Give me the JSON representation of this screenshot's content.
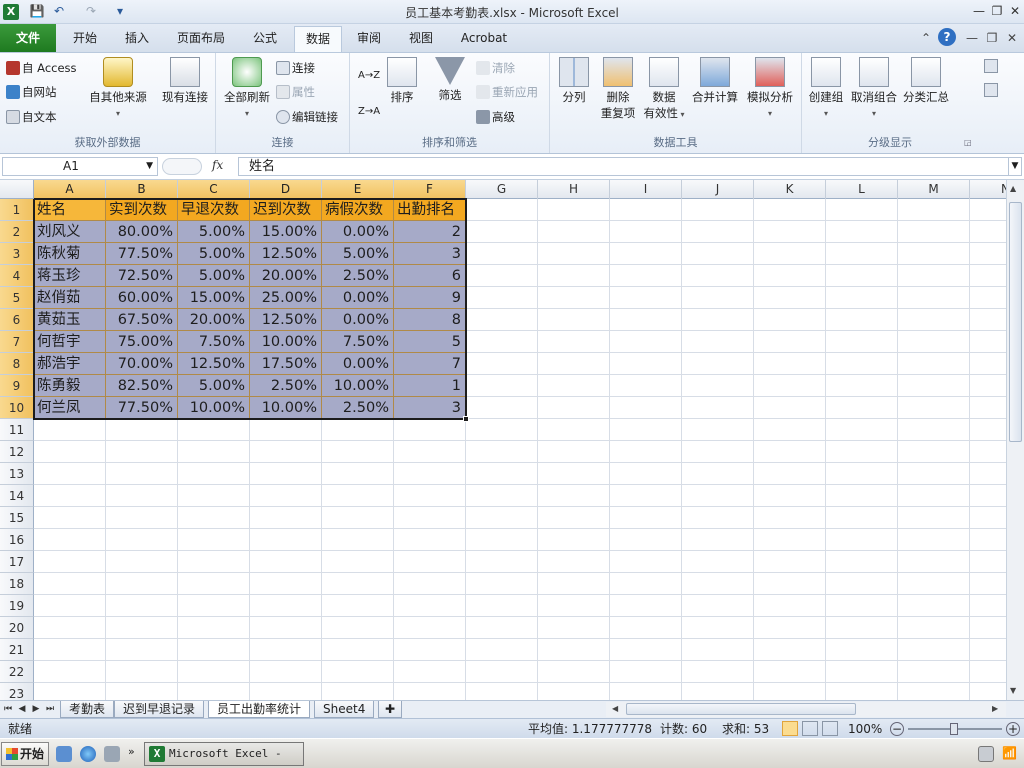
{
  "window": {
    "title": "员工基本考勤表.xlsx - Microsoft Excel",
    "minimize": "—",
    "restore": "❐",
    "close": "✕"
  },
  "qat": {
    "save": "💾",
    "undo": "↶",
    "redo": "↷",
    "customize": "▾"
  },
  "tabs": [
    {
      "label": "文件"
    },
    {
      "label": "开始"
    },
    {
      "label": "插入"
    },
    {
      "label": "页面布局"
    },
    {
      "label": "公式"
    },
    {
      "label": "数据"
    },
    {
      "label": "审阅"
    },
    {
      "label": "视图"
    },
    {
      "label": "Acrobat"
    }
  ],
  "ribbon_right": {
    "collapse": "⌃",
    "help": "?"
  },
  "ribbon": {
    "get_external": {
      "label": "获取外部数据",
      "access": "自 Access",
      "web": "自网站",
      "text": "自文本",
      "other": "自其他来源",
      "existing": "现有连接"
    },
    "connections": {
      "label": "连接",
      "refresh_all": "全部刷新",
      "connections": "连接",
      "properties": "属性",
      "edit_links": "编辑链接"
    },
    "sort_filter": {
      "label": "排序和筛选",
      "sort_az": "A→Z",
      "sort_za": "Z→A",
      "sort": "排序",
      "filter": "筛选",
      "clear": "清除",
      "reapply": "重新应用",
      "advanced": "高级"
    },
    "data_tools": {
      "label": "数据工具",
      "text_to_columns": "分列",
      "remove_dup_1": "删除",
      "remove_dup_2": "重复项",
      "validation_1": "数据",
      "validation_2": "有效性",
      "consolidate": "合并计算",
      "what_if": "模拟分析"
    },
    "outline": {
      "label": "分级显示",
      "group": "创建组",
      "ungroup": "取消组合",
      "subtotal": "分类汇总"
    }
  },
  "formula_bar": {
    "name_box": "A1",
    "fx": "fx",
    "content": "姓名"
  },
  "columns": [
    "A",
    "B",
    "C",
    "D",
    "E",
    "F",
    "G",
    "H",
    "I",
    "J",
    "K",
    "L",
    "M",
    "N"
  ],
  "rows": [
    "1",
    "2",
    "3",
    "4",
    "5",
    "6",
    "7",
    "8",
    "9",
    "10",
    "11",
    "12",
    "13",
    "14",
    "15",
    "16",
    "17",
    "18",
    "19",
    "20",
    "21",
    "22",
    "23"
  ],
  "table": {
    "headers": [
      "姓名",
      "实到次数",
      "早退次数",
      "迟到次数",
      "病假次数",
      "出勤排名"
    ],
    "rows": [
      [
        "刘风义",
        "80.00%",
        "5.00%",
        "15.00%",
        "0.00%",
        "2"
      ],
      [
        "陈秋菊",
        "77.50%",
        "5.00%",
        "12.50%",
        "5.00%",
        "3"
      ],
      [
        "蒋玉珍",
        "72.50%",
        "5.00%",
        "20.00%",
        "2.50%",
        "6"
      ],
      [
        "赵俏茹",
        "60.00%",
        "15.00%",
        "25.00%",
        "0.00%",
        "9"
      ],
      [
        "黄茹玉",
        "67.50%",
        "20.00%",
        "12.50%",
        "0.00%",
        "8"
      ],
      [
        "何哲宇",
        "75.00%",
        "7.50%",
        "10.00%",
        "7.50%",
        "5"
      ],
      [
        "郝浩宇",
        "70.00%",
        "12.50%",
        "17.50%",
        "0.00%",
        "7"
      ],
      [
        "陈勇毅",
        "82.50%",
        "5.00%",
        "2.50%",
        "10.00%",
        "1"
      ],
      [
        "何兰凤",
        "77.50%",
        "10.00%",
        "10.00%",
        "2.50%",
        "3"
      ]
    ]
  },
  "sheets": [
    {
      "label": "考勤表"
    },
    {
      "label": "迟到早退记录"
    },
    {
      "label": "员工出勤率统计"
    },
    {
      "label": "Sheet4"
    }
  ],
  "status": {
    "ready": "就绪",
    "average": "平均值: 1.177777778",
    "count": "计数: 60",
    "sum": "求和: 53",
    "zoom": "100%"
  },
  "taskbar": {
    "start": "开始",
    "app": "Microsoft Excel - ..."
  },
  "colors": {
    "selection": "#a6aac8",
    "header_fill": "#f3a820",
    "excel_green": "#1f7a35"
  }
}
